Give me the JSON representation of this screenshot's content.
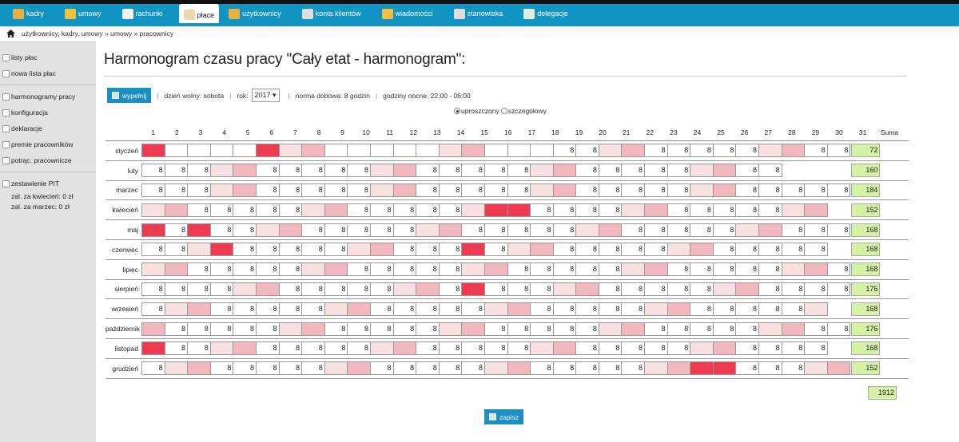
{
  "nav": {
    "tabs": [
      {
        "label": "kadry",
        "icon": "people-icon",
        "color": "#e8b040"
      },
      {
        "label": "umowy",
        "icon": "folder-icon",
        "color": "#f0c040"
      },
      {
        "label": "rachunki",
        "icon": "document-icon",
        "color": "#f2f2f2"
      },
      {
        "label": "płace",
        "icon": "clipboard-icon",
        "color": "#e8d8b0",
        "active": true
      },
      {
        "label": "użytkownicy",
        "icon": "user-icon",
        "color": "#e8b040"
      },
      {
        "label": "konta klientów",
        "icon": "id-card-icon",
        "color": "#dddddd"
      },
      {
        "label": "wiadomości",
        "icon": "folder-icon",
        "color": "#f0c040"
      },
      {
        "label": "stanowiska",
        "icon": "book-icon",
        "color": "#dddddd"
      },
      {
        "label": "delegacje",
        "icon": "calendar-icon",
        "color": "#dfeedd"
      }
    ]
  },
  "breadcrumb": "użytkownicy, kadry, umowy  »  umowy  »  pracownicy",
  "sidebar": {
    "group1": [
      "listy płac",
      "nowa lista płac"
    ],
    "group2": [
      "harmonogramy pracy",
      "konfiguracja",
      "deklaracje",
      "premie pracowników",
      "potrąc. pracownicze"
    ],
    "group3_title": "zestawienie PIT",
    "group3_lines": [
      "zal. za kwiecień: 0 zł",
      "zal. za marzec: 0 zł"
    ]
  },
  "page_title": "Harmonogram czasu pracy \"Cały etat - harmonogram\":",
  "toolbar": {
    "fill_label": "wypełnij",
    "day_off": "dzień wolny: sobota",
    "year_label": "rok:",
    "year_value": "2017 ▾",
    "daily_norm": "norma dobowa: 8 godzin",
    "night_hours": "godziny nocne: 22:00 - 06:00"
  },
  "view_mode": {
    "simple": "uproszczony",
    "detailed": "szczegółowy",
    "selected": "uproszczony"
  },
  "grid": {
    "days": [
      "1",
      "2",
      "3",
      "4",
      "5",
      "6",
      "7",
      "8",
      "9",
      "10",
      "11",
      "12",
      "13",
      "14",
      "15",
      "16",
      "17",
      "18",
      "19",
      "20",
      "21",
      "22",
      "23",
      "24",
      "25",
      "26",
      "27",
      "28",
      "29",
      "30",
      "31"
    ],
    "sum_header": "Suma",
    "months": [
      {
        "name": "styczeń",
        "cells": [
          "h:",
          "w:",
          "w:",
          "w:",
          "w:",
          "h:",
          "l:",
          "m:",
          "w:",
          "w:",
          "w:",
          "w:",
          "w:",
          "l:",
          "m:",
          "w:",
          "w:",
          "w:",
          "w:8",
          "w:8",
          "l:",
          "m:",
          "w:8",
          "w:8",
          "w:8",
          "w:8",
          "w:8",
          "l:",
          "m:",
          "w:8",
          "w:8"
        ],
        "sum": "72"
      },
      {
        "name": "luty",
        "cells": [
          "w:8",
          "w:8",
          "w:8",
          "l:",
          "m:",
          "w:8",
          "w:8",
          "w:8",
          "w:8",
          "w:8",
          "l:",
          "m:",
          "w:8",
          "w:8",
          "w:8",
          "w:8",
          "w:8",
          "l:",
          "m:",
          "w:8",
          "w:8",
          "w:8",
          "w:8",
          "w:8",
          "l:",
          "m:",
          "w:8",
          "w:8",
          "x:",
          "x:",
          "x:"
        ],
        "sum": "160"
      },
      {
        "name": "marzec",
        "cells": [
          "w:8",
          "w:8",
          "w:8",
          "l:",
          "m:",
          "w:8",
          "w:8",
          "w:8",
          "w:8",
          "w:8",
          "l:",
          "m:",
          "w:8",
          "w:8",
          "w:8",
          "w:8",
          "w:8",
          "l:",
          "m:",
          "w:8",
          "w:8",
          "w:8",
          "w:8",
          "w:8",
          "l:",
          "m:",
          "w:8",
          "w:8",
          "w:8",
          "w:8",
          "w:8"
        ],
        "sum": "184"
      },
      {
        "name": "kwiecień",
        "cells": [
          "l:",
          "m:",
          "w:8",
          "w:8",
          "w:8",
          "w:8",
          "w:8",
          "l:",
          "m:",
          "w:8",
          "w:8",
          "w:8",
          "w:8",
          "w:8",
          "l:",
          "h:",
          "h:",
          "w:8",
          "w:8",
          "w:8",
          "w:8",
          "l:",
          "m:",
          "w:8",
          "w:8",
          "w:8",
          "w:8",
          "w:8",
          "l:",
          "m:",
          "x:"
        ],
        "sum": "152"
      },
      {
        "name": "maj",
        "cells": [
          "h:",
          "w:8",
          "h:",
          "w:8",
          "w:8",
          "l:",
          "m:",
          "w:8",
          "w:8",
          "w:8",
          "w:8",
          "w:8",
          "l:",
          "m:",
          "w:8",
          "w:8",
          "w:8",
          "w:8",
          "w:8",
          "l:",
          "m:",
          "w:8",
          "w:8",
          "w:8",
          "w:8",
          "w:8",
          "l:",
          "m:",
          "w:8",
          "w:8",
          "w:8"
        ],
        "sum": "168"
      },
      {
        "name": "czerwiec",
        "cells": [
          "w:8",
          "w:8",
          "l:",
          "h:",
          "w:8",
          "w:8",
          "w:8",
          "w:8",
          "w:8",
          "l:",
          "m:",
          "w:8",
          "w:8",
          "w:8",
          "h:",
          "w:8",
          "l:",
          "m:",
          "w:8",
          "w:8",
          "w:8",
          "w:8",
          "w:8",
          "l:",
          "m:",
          "w:8",
          "w:8",
          "w:8",
          "w:8",
          "w:8",
          "x:"
        ],
        "sum": "168"
      },
      {
        "name": "lipiec",
        "cells": [
          "l:",
          "m:",
          "w:8",
          "w:8",
          "w:8",
          "w:8",
          "w:8",
          "l:",
          "m:",
          "w:8",
          "w:8",
          "w:8",
          "w:8",
          "w:8",
          "l:",
          "m:",
          "w:8",
          "w:8",
          "w:8",
          "w:8",
          "w:8",
          "l:",
          "m:",
          "w:8",
          "w:8",
          "w:8",
          "w:8",
          "w:8",
          "l:",
          "m:",
          "w:8"
        ],
        "sum": "168"
      },
      {
        "name": "sierpień",
        "cells": [
          "w:8",
          "w:8",
          "w:8",
          "w:8",
          "l:",
          "m:",
          "w:8",
          "w:8",
          "w:8",
          "w:8",
          "w:8",
          "l:",
          "m:",
          "w:8",
          "h:",
          "w:8",
          "w:8",
          "w:8",
          "l:",
          "m:",
          "w:8",
          "w:8",
          "w:8",
          "w:8",
          "w:8",
          "l:",
          "m:",
          "w:8",
          "w:8",
          "w:8",
          "w:8"
        ],
        "sum": "176"
      },
      {
        "name": "wrzesień",
        "cells": [
          "w:8",
          "l:",
          "m:",
          "w:8",
          "w:8",
          "w:8",
          "w:8",
          "w:8",
          "l:",
          "m:",
          "w:8",
          "w:8",
          "w:8",
          "w:8",
          "w:8",
          "l:",
          "m:",
          "w:8",
          "w:8",
          "w:8",
          "w:8",
          "w:8",
          "l:",
          "m:",
          "w:8",
          "w:8",
          "w:8",
          "w:8",
          "w:8",
          "l:",
          "x:"
        ],
        "sum": "168"
      },
      {
        "name": "październik",
        "cells": [
          "m:",
          "w:8",
          "w:8",
          "w:8",
          "w:8",
          "w:8",
          "l:",
          "m:",
          "w:8",
          "w:8",
          "w:8",
          "w:8",
          "w:8",
          "l:",
          "m:",
          "w:8",
          "w:8",
          "w:8",
          "w:8",
          "w:8",
          "l:",
          "m:",
          "w:8",
          "w:8",
          "w:8",
          "w:8",
          "w:8",
          "l:",
          "m:",
          "w:8",
          "w:8"
        ],
        "sum": "176"
      },
      {
        "name": "listopad",
        "cells": [
          "h:",
          "w:8",
          "w:8",
          "l:",
          "m:",
          "w:8",
          "w:8",
          "w:8",
          "w:8",
          "w:8",
          "l:",
          "m:",
          "w:8",
          "w:8",
          "w:8",
          "w:8",
          "w:8",
          "l:",
          "m:",
          "w:8",
          "w:8",
          "w:8",
          "w:8",
          "w:8",
          "l:",
          "m:",
          "w:8",
          "w:8",
          "w:8",
          "w:8",
          "x:"
        ],
        "sum": "168"
      },
      {
        "name": "grudzień",
        "cells": [
          "w:8",
          "l:",
          "m:",
          "w:8",
          "w:8",
          "w:8",
          "w:8",
          "w:8",
          "l:",
          "m:",
          "w:8",
          "w:8",
          "w:8",
          "w:8",
          "w:8",
          "l:",
          "m:",
          "w:8",
          "w:8",
          "w:8",
          "w:8",
          "w:8",
          "l:",
          "m:",
          "h:",
          "h:",
          "w:8",
          "w:8",
          "w:8",
          "l:",
          "m:"
        ],
        "sum": "152"
      }
    ],
    "total": "1912"
  },
  "save_label": "zapisz",
  "colors": {
    "accent": "#0f94c4",
    "holiday": "#ee3b52",
    "sunday": "#f2b8c0",
    "saturday": "#f7dfe2",
    "sum": "#d6f0a6"
  }
}
